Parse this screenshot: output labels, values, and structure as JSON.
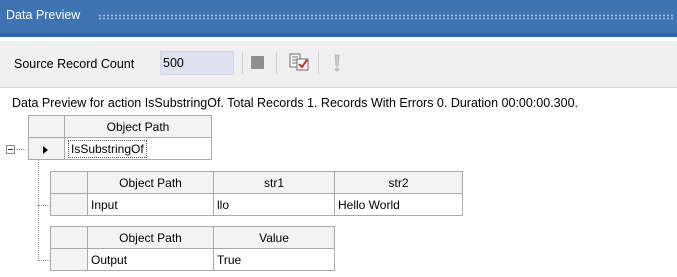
{
  "panel": {
    "title": "Data Preview"
  },
  "toolbar": {
    "source_count_label": "Source Record Count",
    "source_count_value": "500",
    "stop_icon": "stop-icon",
    "preview_icon": "preview-check-icon",
    "execute_icon": "exclamation-icon"
  },
  "status": {
    "text": "Data Preview for action IsSubstringOf. Total Records 1. Records With Errors 0. Duration 00:00:00.300."
  },
  "outer_grid": {
    "header": "Object Path",
    "row_value": "IsSubstringOf"
  },
  "input_grid": {
    "headers": [
      "Object Path",
      "str1",
      "str2"
    ],
    "row": [
      "Input",
      "llo",
      "Hello World"
    ]
  },
  "output_grid": {
    "headers": [
      "Object Path",
      "Value"
    ],
    "row": [
      "Output",
      "True"
    ]
  }
}
